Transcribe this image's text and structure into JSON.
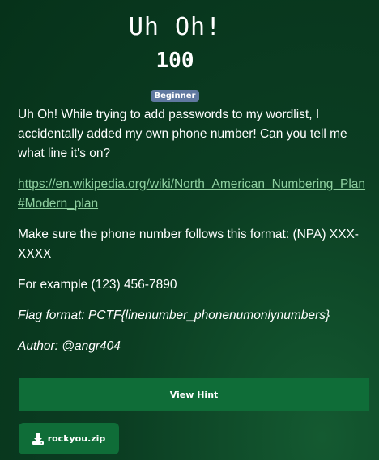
{
  "challenge": {
    "title": "Uh Oh!",
    "points": "100",
    "difficulty": "Beginner"
  },
  "description": {
    "intro": "Uh Oh! While trying to add passwords to my wordlist, I accidentally added my own phone number! Can you tell me what line it's on?",
    "link": "https://en.wikipedia.org/wiki/North_American_Numbering_Plan#Modern_plan",
    "format_note": "Make sure the phone number follows this format: (NPA) XXX-XXXX",
    "example": "For example (123) 456-7890",
    "flag_format": "Flag format: PCTF{linenumber_phonenumonlynumbers}",
    "author": "Author: @angr404"
  },
  "buttons": {
    "hint_label": "View Hint",
    "file_label": "rockyou.zip",
    "file_icon": "download-icon"
  },
  "colors": {
    "background": "#073a1e",
    "button": "#0f6d38",
    "badge": "#6079a0",
    "link": "#8fd0a0"
  }
}
